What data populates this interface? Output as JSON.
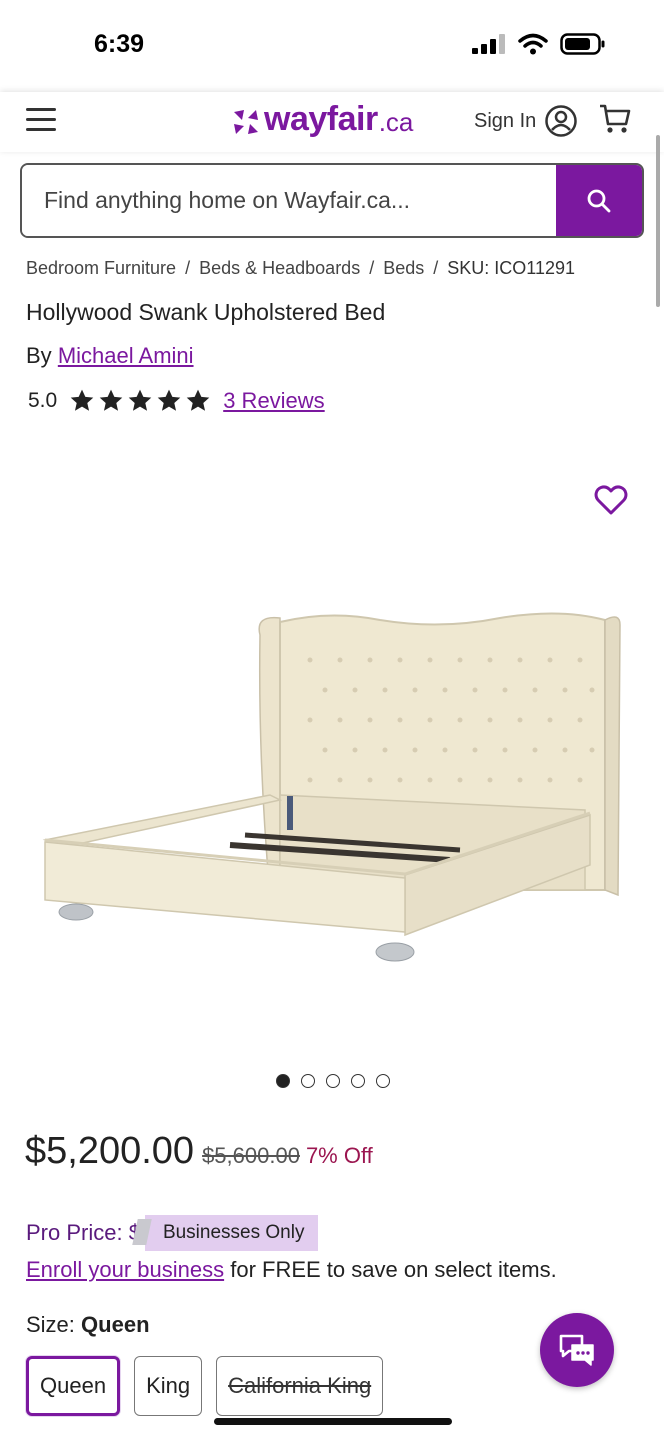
{
  "status_bar": {
    "time": "6:39"
  },
  "header": {
    "logo_text": "wayfair",
    "logo_tld": ".ca",
    "signin_label": "Sign In"
  },
  "search": {
    "placeholder": "Find anything home on Wayfair.ca..."
  },
  "breadcrumb": {
    "items": [
      "Bedroom Furniture",
      "Beds & Headboards",
      "Beds"
    ],
    "separator": "/",
    "sku": "SKU: ICO11291"
  },
  "product": {
    "title": "Hollywood Swank Upholstered Bed",
    "by_prefix": "By",
    "brand": "Michael Amini",
    "rating_value": "5.0",
    "rating_stars": 5,
    "reviews_label": "3 Reviews"
  },
  "gallery": {
    "total_images": 5,
    "active_index": 0
  },
  "pricing": {
    "price": "$5,200.00",
    "original_price": "$5,600.00",
    "discount": "7% Off",
    "pro_price_label": "Pro Price: $",
    "pro_badge": "Businesses Only",
    "enroll_link": "Enroll your business",
    "enroll_rest": " for FREE to save on select items."
  },
  "size": {
    "label": "Size:",
    "selected": "Queen",
    "options": [
      "Queen",
      "King",
      "California King"
    ]
  },
  "colors": {
    "brand": "#7b189f",
    "discount": "#9b1650"
  }
}
